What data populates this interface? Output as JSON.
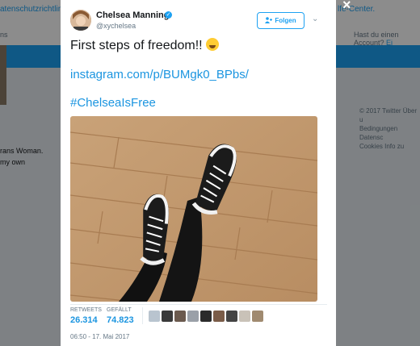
{
  "background": {
    "banner_left": "atenschutzrichtlinie",
    "banner_right": "lfe-Center.",
    "nav_left": "ns",
    "nav_right_prefix": "Hast du einen Account?",
    "nav_right_link": "Ei",
    "bio_line1": "rans Woman.",
    "bio_line2": "my own",
    "footer_line1": "© 2017 Twitter  Über u",
    "footer_line2": "Bedingungen  Datensc",
    "footer_line3": "Cookies  Info zu"
  },
  "tweet": {
    "author_name": "Chelsea Manning",
    "author_handle": "@xychelsea",
    "follow_label": "Folgen",
    "text": "First steps of freedom!!",
    "link": "instagram.com/p/BUMgk0_BPbs/",
    "hashtag": "#ChelseaIsFree",
    "retweets_label": "RETWEETS",
    "retweets_value": "26.314",
    "likes_label": "GEFÄLLT",
    "likes_value": "74.823",
    "timestamp": "06:50 - 17. Mai 2017",
    "icons": [
      "verified-badge-icon",
      "add-user-icon",
      "chevron-down-icon",
      "close-icon",
      "grinning-emoji"
    ],
    "liker_colors": [
      "#b9c4cf",
      "#3a3a3a",
      "#6b5a4e",
      "#9aa0a8",
      "#2b2b2b",
      "#7a5c48",
      "#444444",
      "#c9c2b8",
      "#a08a70"
    ],
    "accent_color": "#1da1f2"
  }
}
